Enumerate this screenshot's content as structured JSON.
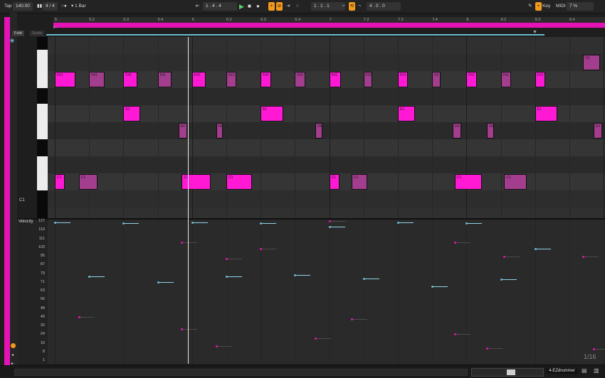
{
  "transport": {
    "key_label": "Tap",
    "tempo": "140.00",
    "signature": "4 / 4",
    "quantize": "1 Bar",
    "position": "1 .  4 .  4",
    "loop_start": "1 .  1 .  1",
    "loop_length": "4 .  0 .  0",
    "key_button": "Key",
    "midi_button": "MIDI",
    "cpu": "7 %"
  },
  "ruler_marks": [
    "5",
    "5.2",
    "5.3",
    "5.4",
    "6",
    "6.2",
    "6.3",
    "6.4",
    "7",
    "7.2",
    "7.3",
    "7.4",
    "8",
    "8.2",
    "8.3",
    "8.4"
  ],
  "editor": {
    "fold_button": "Fold",
    "scale_button": "Scale",
    "c1_label": "C1",
    "velocity_title": "Velocity",
    "velocity_ticks": [
      "127",
      "119",
      "111",
      "103",
      "95",
      "87",
      "79",
      "71",
      "63",
      "56",
      "48",
      "40",
      "32",
      "24",
      "16",
      "8",
      "1"
    ],
    "zoom_readout": "1/16",
    "track_name": "4-EZdrummer"
  },
  "notes": [
    {
      "label": "F#1",
      "pitch": "F#1",
      "start": 0,
      "length": 0.6,
      "style": "bright"
    },
    {
      "label": "F#1",
      "pitch": "F#1",
      "start": 1,
      "length": 0.45,
      "style": "dim"
    },
    {
      "label": "F#1",
      "pitch": "F#1",
      "start": 2,
      "length": 0.4,
      "style": "bright"
    },
    {
      "label": "F#1",
      "pitch": "F#1",
      "start": 3,
      "length": 0.4,
      "style": "dim"
    },
    {
      "label": "F#1",
      "pitch": "F#1",
      "start": 4,
      "length": 0.4,
      "style": "bright"
    },
    {
      "label": "F#1",
      "pitch": "F#1",
      "start": 5,
      "length": 0.3,
      "style": "dim"
    },
    {
      "label": "F#1",
      "pitch": "F#1",
      "start": 6,
      "length": 0.3,
      "style": "bright"
    },
    {
      "label": "F#1",
      "pitch": "F#1",
      "start": 7,
      "length": 0.3,
      "style": "dim"
    },
    {
      "label": "F#1",
      "pitch": "F#1",
      "start": 8,
      "length": 0.35,
      "style": "bright"
    },
    {
      "label": "F#1",
      "pitch": "F#1",
      "start": 9,
      "length": 0.25,
      "style": "dim"
    },
    {
      "label": "F#1",
      "pitch": "F#1",
      "start": 10,
      "length": 0.3,
      "style": "bright"
    },
    {
      "label": "F#",
      "pitch": "F#1",
      "start": 11,
      "length": 0.25,
      "style": "dim"
    },
    {
      "label": "F#1",
      "pitch": "F#1",
      "start": 12,
      "length": 0.3,
      "style": "bright"
    },
    {
      "label": "F#1",
      "pitch": "F#1",
      "start": 13,
      "length": 0.3,
      "style": "dim"
    },
    {
      "label": "F#1",
      "pitch": "F#1",
      "start": 14,
      "length": 0.3,
      "style": "bright"
    },
    {
      "label": "G1",
      "pitch": "G#1",
      "start": 15.4,
      "length": 0.5,
      "style": "dim"
    },
    {
      "label": "E1",
      "pitch": "E1",
      "start": 2,
      "length": 0.5,
      "style": "bright"
    },
    {
      "label": "E1",
      "pitch": "E1",
      "start": 6,
      "length": 0.65,
      "style": "bright"
    },
    {
      "label": "E1",
      "pitch": "E1",
      "start": 10,
      "length": 0.5,
      "style": "bright"
    },
    {
      "label": "E1",
      "pitch": "E1",
      "start": 14,
      "length": 0.65,
      "style": "bright"
    },
    {
      "label": "D#",
      "pitch": "D#1",
      "start": 3.6,
      "length": 0.25,
      "style": "dim"
    },
    {
      "label": "D#",
      "pitch": "D#1",
      "start": 4.7,
      "length": 0.2,
      "style": "dim"
    },
    {
      "label": "D#",
      "pitch": "D#1",
      "start": 7.6,
      "length": 0.2,
      "style": "dim"
    },
    {
      "label": "D#",
      "pitch": "D#1",
      "start": 11.6,
      "length": 0.25,
      "style": "dim"
    },
    {
      "label": "D#",
      "pitch": "D#1",
      "start": 12.6,
      "length": 0.2,
      "style": "dim"
    },
    {
      "label": "D#",
      "pitch": "D#1",
      "start": 15.7,
      "length": 0.25,
      "style": "dim"
    },
    {
      "label": "C1",
      "pitch": "C1",
      "start": 0,
      "length": 0.3,
      "style": "bright"
    },
    {
      "label": "C1",
      "pitch": "C1",
      "start": 0.7,
      "length": 0.55,
      "style": "dim"
    },
    {
      "label": "C1",
      "pitch": "C1",
      "start": 3.7,
      "length": 0.85,
      "style": "bright"
    },
    {
      "label": "C1",
      "pitch": "C1",
      "start": 5,
      "length": 0.75,
      "style": "bright"
    },
    {
      "label": "C1",
      "pitch": "C1",
      "start": 8,
      "length": 0.3,
      "style": "bright"
    },
    {
      "label": "C1",
      "pitch": "C1",
      "start": 8.65,
      "length": 0.45,
      "style": "dim"
    },
    {
      "label": "C1",
      "pitch": "C1",
      "start": 11.65,
      "length": 0.8,
      "style": "bright"
    },
    {
      "label": "C1",
      "pitch": "C1",
      "start": 13.1,
      "length": 0.65,
      "style": "dim"
    }
  ],
  "velocities": [
    {
      "start": 0,
      "value": 126,
      "color": "#69b9d1"
    },
    {
      "start": 1,
      "value": 77,
      "color": "#69b9d1"
    },
    {
      "start": 2,
      "value": 125,
      "color": "#69b9d1"
    },
    {
      "start": 3,
      "value": 72,
      "color": "#69b9d1"
    },
    {
      "start": 4,
      "value": 126,
      "color": "#69b9d1"
    },
    {
      "start": 5,
      "value": 77,
      "color": "#69b9d1"
    },
    {
      "start": 6,
      "value": 125,
      "color": "#69b9d1"
    },
    {
      "start": 7,
      "value": 78,
      "color": "#69b9d1"
    },
    {
      "start": 8,
      "value": 122,
      "color": "#69b9d1"
    },
    {
      "start": 9,
      "value": 75,
      "color": "#69b9d1"
    },
    {
      "start": 10,
      "value": 126,
      "color": "#69b9d1"
    },
    {
      "start": 11,
      "value": 68,
      "color": "#69b9d1"
    },
    {
      "start": 12,
      "value": 125,
      "color": "#69b9d1"
    },
    {
      "start": 13,
      "value": 74,
      "color": "#69b9d1"
    },
    {
      "start": 14,
      "value": 102,
      "color": "#69b9d1"
    },
    {
      "start": 0.7,
      "value": 40,
      "color": "#e513b5"
    },
    {
      "start": 3.7,
      "value": 108,
      "color": "#e513b5"
    },
    {
      "start": 3.7,
      "value": 29,
      "color": "#e513b5"
    },
    {
      "start": 5,
      "value": 93,
      "color": "#e513b5"
    },
    {
      "start": 6,
      "value": 102,
      "color": "#e513b5"
    },
    {
      "start": 4.7,
      "value": 14,
      "color": "#e513b5"
    },
    {
      "start": 7.6,
      "value": 21,
      "color": "#e513b5"
    },
    {
      "start": 8.65,
      "value": 38,
      "color": "#e513b5"
    },
    {
      "start": 11.65,
      "value": 108,
      "color": "#e513b5"
    },
    {
      "start": 11.65,
      "value": 25,
      "color": "#e513b5"
    },
    {
      "start": 13.1,
      "value": 95,
      "color": "#e513b5"
    },
    {
      "start": 12.6,
      "value": 12,
      "color": "#e513b5"
    },
    {
      "start": 15.4,
      "value": 95,
      "color": "#e513b5"
    },
    {
      "start": 15.7,
      "value": 11,
      "color": "#e513b5"
    },
    {
      "start": 8,
      "value": 127,
      "color": "#e513b5"
    }
  ],
  "colors": {
    "accent": "#e513b5",
    "note_bright": "#ff19d4",
    "note_dim": "#a33d8d",
    "loop": "#69b9d1",
    "transport_active": "#f39a1c"
  }
}
